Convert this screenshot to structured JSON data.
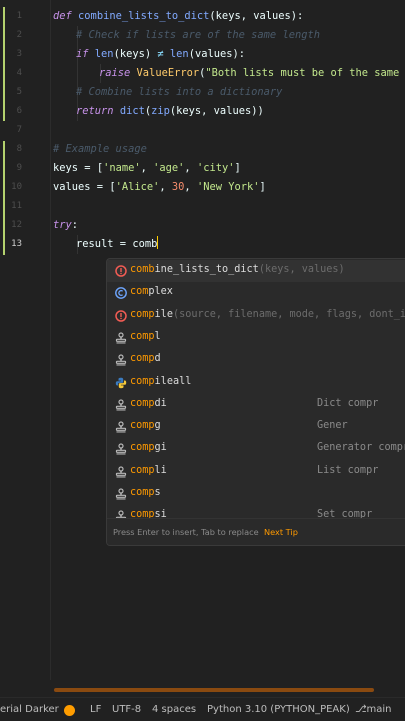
{
  "editor": {
    "line_numbers": [
      "1",
      "2",
      "3",
      "4",
      "5",
      "6",
      "7",
      "8",
      "9",
      "10",
      "11",
      "12",
      "13"
    ],
    "active_line": "13",
    "lines": {
      "l1": {
        "kw": "def",
        "name": "combine_lists_to_dict",
        "args": "(keys, values):"
      },
      "l2": {
        "comment": "# Check if lists are of the same length"
      },
      "l3": {
        "kw": "if",
        "fn": "len",
        "a": "(keys)",
        "op": "≠",
        "fn2": "len",
        "b": "(values):"
      },
      "l4": {
        "kw": "raise",
        "cls": "ValueError",
        "open": "(",
        "str": "\"Both lists must be of the same len"
      },
      "l5": {
        "comment": "# Combine lists into a dictionary"
      },
      "l6": {
        "kw": "return",
        "fn": "dict",
        "fn2": "zip",
        "rest": "(keys, values))"
      },
      "l8": {
        "comment": "# Example usage"
      },
      "l9": {
        "var": "keys",
        "eq": " = ",
        "open": "[",
        "s1": "'name'",
        "s2": "'age'",
        "s3": "'city'",
        "close": "]"
      },
      "l10": {
        "var": "values",
        "eq": " = ",
        "open": "[",
        "s1": "'Alice'",
        "num": "30",
        "s3": "'New York'",
        "close": "]"
      },
      "l12": {
        "kw": "try",
        "colon": ":"
      },
      "l13": {
        "var": "result",
        "eq": " = ",
        "typed": "comb"
      }
    }
  },
  "completion": {
    "items": [
      {
        "icon": "error-icon",
        "match": "comb",
        "rest": "ine_lists_to_dict",
        "params": "(keys, values)",
        "type": ""
      },
      {
        "icon": "class-icon",
        "match": "com",
        "rest": "plex",
        "params": "",
        "type": ""
      },
      {
        "icon": "error-icon",
        "match": "comp",
        "rest": "ile",
        "params": "(source, filename, mode, flags, dont_inh",
        "type": ""
      },
      {
        "icon": "stamp-icon",
        "match": "comp",
        "rest": "l",
        "params": "",
        "type": ""
      },
      {
        "icon": "stamp-icon",
        "match": "comp",
        "rest": "d",
        "params": "",
        "type": ""
      },
      {
        "icon": "python-icon",
        "match": "comp",
        "rest": "ileall",
        "params": "",
        "type": ""
      },
      {
        "icon": "stamp-icon",
        "match": "comp",
        "rest": "di",
        "params": "",
        "type": "Dict compr"
      },
      {
        "icon": "stamp-icon",
        "match": "comp",
        "rest": "g",
        "params": "",
        "type": "Gener"
      },
      {
        "icon": "stamp-icon",
        "match": "comp",
        "rest": "gi",
        "params": "",
        "type": "Generator compr"
      },
      {
        "icon": "stamp-icon",
        "match": "comp",
        "rest": "li",
        "params": "",
        "type": "List compr"
      },
      {
        "icon": "stamp-icon",
        "match": "comp",
        "rest": "s",
        "params": "",
        "type": ""
      },
      {
        "icon": "stamp-icon",
        "match": "comp",
        "rest": "si",
        "params": "",
        "type": "Set compr"
      }
    ],
    "footer_hint": "Press Enter to insert, Tab to replace",
    "footer_tip": "Next Tip"
  },
  "statusbar": {
    "theme": "erial Darker",
    "line_sep": "LF",
    "encoding": "UTF-8",
    "indent": "4 spaces",
    "interpreter": "Python 3.10 (PYTHON_PEAK)",
    "branch": "main",
    "indicator_color": "#ff9d00"
  },
  "colors": {
    "match": "#ff9a00",
    "keyword": "#c792ea",
    "function": "#82aaff",
    "string": "#c3e88d",
    "number": "#f78c6c",
    "comment": "#4a5a6a"
  }
}
